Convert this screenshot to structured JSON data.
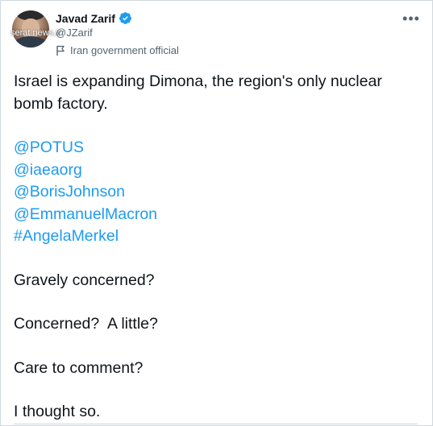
{
  "author": {
    "name": "Javad Zarif",
    "handle": "@JZarif",
    "label": "Iran government official",
    "avatar_watermark": "serat news.ir"
  },
  "icons": {
    "verified": "verified-badge-icon",
    "label": "flag-icon",
    "more": "more-options-icon"
  },
  "colors": {
    "link": "#1d9bf0",
    "verified": "#1d9bf0",
    "text": "#0f1419",
    "secondary": "#536471"
  },
  "tweet": {
    "line1": "Israel is expanding Dimona, the region's only nuclear bomb factory.",
    "mentions": [
      "@POTUS",
      "@iaeaorg",
      "@BorisJohnson",
      "@EmmanuelMacron",
      "#AngelaMerkel"
    ],
    "line2": "Gravely concerned?",
    "line3": "Concerned?  A little?",
    "line4": "Care to comment?",
    "line5": "I thought so."
  }
}
